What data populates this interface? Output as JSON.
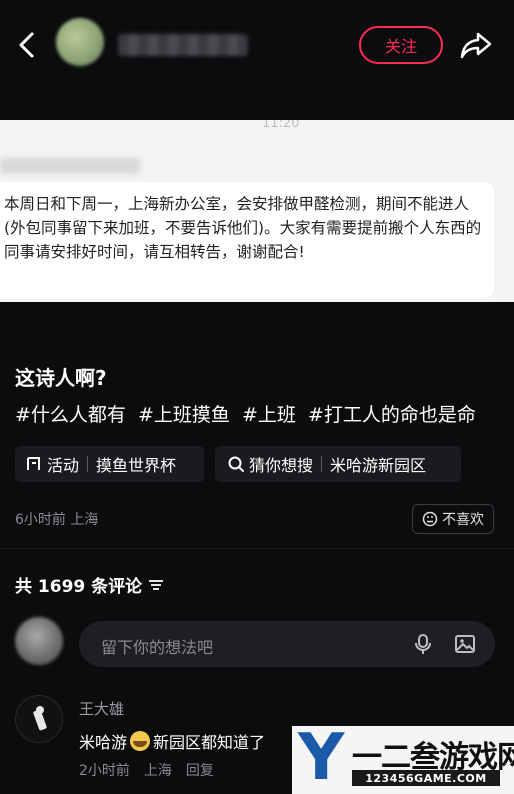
{
  "header": {
    "follow_label": "关注"
  },
  "notice": {
    "time": "11:20",
    "body": "本周日和下周一，上海新办公室，会安排做甲醛检测，期间不能进人(外包同事留下来加班，不要告诉他们)。大家有需要提前搬个人东西的同事请安排好时间，请互相转告，谢谢配合!"
  },
  "post": {
    "title": "这诗人啊?",
    "tags": [
      "#什么人都有",
      "#上班摸鱼",
      "#上班",
      "#打工人的命也是命"
    ],
    "chip1": {
      "label": "活动",
      "value": "摸鱼世界杯"
    },
    "chip2": {
      "label": "猜你想搜",
      "value": "米哈游新园区"
    },
    "meta": "6小时前 上海",
    "dislike_label": "不喜欢"
  },
  "comments": {
    "count_label": "共 1699 条评论",
    "input_placeholder": "留下你的想法吧",
    "items": [
      {
        "author": "王大雄",
        "text_before": "米哈游",
        "text_after": "新园区都知道了",
        "time": "2小时前",
        "location": "上海",
        "reply_label": "回复"
      }
    ]
  },
  "watermark": {
    "letter": "Y",
    "title": "一二叁游戏网",
    "url": "123456GAME.COM"
  },
  "colors": {
    "background": "#0c0c0f",
    "accent": "#fe2c55",
    "watermark_blue": "#1a5aa8"
  },
  "icons": {
    "back": "chevron-left-icon",
    "share": "share-arrow-icon",
    "activity": "activity-icon",
    "search": "search-icon",
    "dislike": "frown-face-icon",
    "sort": "sort-lines-icon",
    "mic": "microphone-icon",
    "image": "image-icon"
  }
}
